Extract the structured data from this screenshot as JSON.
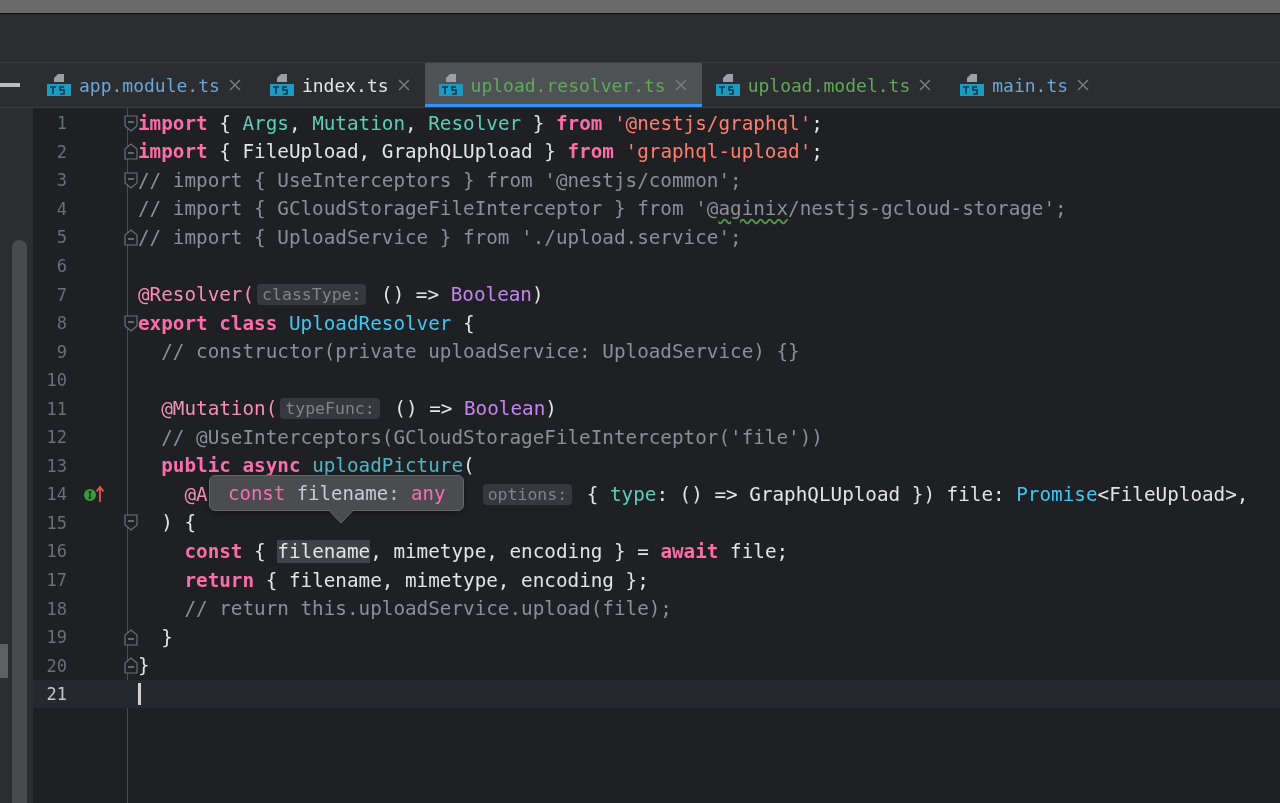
{
  "tabs": [
    {
      "label": "app.module.ts",
      "color": "#6aa7d8",
      "selected": false
    },
    {
      "label": "index.ts",
      "color": "#e6e6e6",
      "selected": false
    },
    {
      "label": "upload.resolver.ts",
      "color": "#62a85a",
      "selected": true
    },
    {
      "label": "upload.model.ts",
      "color": "#62a85a",
      "selected": false
    },
    {
      "label": "main.ts",
      "color": "#6aa7d8",
      "selected": false
    }
  ],
  "editor": {
    "lines": [
      {
        "number": "1",
        "fold_start": true,
        "tokens": [
          {
            "kind": "kw",
            "text": "import"
          },
          {
            "kind": "plain",
            "text": " { "
          },
          {
            "kind": "id",
            "text": "Args"
          },
          {
            "kind": "plain",
            "text": ", "
          },
          {
            "kind": "id",
            "text": "Mutation"
          },
          {
            "kind": "plain",
            "text": ", "
          },
          {
            "kind": "id",
            "text": "Resolver"
          },
          {
            "kind": "plain",
            "text": " } "
          },
          {
            "kind": "kw",
            "text": "from"
          },
          {
            "kind": "str",
            "text": " '@nestjs/graphql'"
          },
          {
            "kind": "plain",
            "text": ";"
          }
        ]
      },
      {
        "number": "2",
        "fold_end": true,
        "tokens": [
          {
            "kind": "kw",
            "text": "import"
          },
          {
            "kind": "plain",
            "text": " { FileUpload, GraphQLUpload } "
          },
          {
            "kind": "kw",
            "text": "from"
          },
          {
            "kind": "str",
            "text": " 'graphql-upload'"
          },
          {
            "kind": "plain",
            "text": ";"
          }
        ]
      },
      {
        "number": "3",
        "fold_start": true,
        "tokens": [
          {
            "kind": "com",
            "text": "// import { UseInterceptors } from '@nestjs/common';"
          }
        ]
      },
      {
        "number": "4",
        "tokens": [
          {
            "kind": "com",
            "text": "// import { GCloudStorageFileInterceptor } from '@"
          },
          {
            "kind": "com",
            "text": "aginix",
            "typo": true
          },
          {
            "kind": "com",
            "text": "/nestjs-gcloud-storage';"
          }
        ]
      },
      {
        "number": "5",
        "fold_end": true,
        "tokens": [
          {
            "kind": "com",
            "text": "// import { UploadService } from './upload.service';"
          }
        ]
      },
      {
        "number": "6"
      },
      {
        "number": "7",
        "tokens": [
          {
            "kind": "deco",
            "text": "@Resolver("
          },
          {
            "kind": "hint",
            "text": "classType:"
          },
          {
            "kind": "plain",
            "text": " () => "
          },
          {
            "kind": "type",
            "text": "Boolean"
          },
          {
            "kind": "plain",
            "text": ")"
          }
        ]
      },
      {
        "number": "8",
        "fold_start": true,
        "tokens": [
          {
            "kind": "kw",
            "text": "export class"
          },
          {
            "kind": "cls",
            "text": " UploadResolver"
          },
          {
            "kind": "plain",
            "text": " {"
          }
        ]
      },
      {
        "number": "9",
        "tokens": [
          {
            "kind": "com",
            "text": "  // constructor(private uploadService: UploadService) {}"
          }
        ]
      },
      {
        "number": "10"
      },
      {
        "number": "11",
        "tokens": [
          {
            "kind": "deco",
            "text": "  @Mutation("
          },
          {
            "kind": "hint",
            "text": "typeFunc:"
          },
          {
            "kind": "plain",
            "text": " () => "
          },
          {
            "kind": "type",
            "text": "Boolean"
          },
          {
            "kind": "plain",
            "text": ")"
          }
        ]
      },
      {
        "number": "12",
        "tokens": [
          {
            "kind": "com",
            "text": "  // @UseInterceptors(GCloudStorageFileInterceptor('file'))"
          }
        ]
      },
      {
        "number": "13",
        "tokens": [
          {
            "kind": "kw",
            "text": "  public async"
          },
          {
            "kind": "fn",
            "text": " uploadPicture"
          },
          {
            "kind": "plain",
            "text": "("
          }
        ]
      },
      {
        "number": "14",
        "implements_marker": true,
        "tokens": [
          {
            "kind": "deco",
            "text": "    @A",
            "covered": true
          },
          {
            "kind": "hint",
            "text": "options:"
          },
          {
            "kind": "plain",
            "text": " { "
          },
          {
            "kind": "prop",
            "text": "type"
          },
          {
            "kind": "plain",
            "text": ": () => GraphQLUpload }) file: "
          },
          {
            "kind": "cls",
            "text": "Promise"
          },
          {
            "kind": "plain",
            "text": "<FileUpload>,"
          }
        ]
      },
      {
        "number": "15",
        "fold_start": true,
        "tokens": [
          {
            "kind": "plain",
            "text": "  ) {"
          }
        ]
      },
      {
        "number": "16",
        "tokens": [
          {
            "kind": "kw",
            "text": "    const"
          },
          {
            "kind": "plain",
            "text": " { "
          },
          {
            "kind": "plain",
            "text": "filename",
            "highlighted": true
          },
          {
            "kind": "plain",
            "text": ", mimetype, encoding } = "
          },
          {
            "kind": "kw",
            "text": "await"
          },
          {
            "kind": "plain",
            "text": " file;"
          }
        ]
      },
      {
        "number": "17",
        "tokens": [
          {
            "kind": "kw",
            "text": "    return"
          },
          {
            "kind": "plain",
            "text": " { filename, mimetype, encoding };"
          }
        ]
      },
      {
        "number": "18",
        "tokens": [
          {
            "kind": "com",
            "text": "    // return this.uploadService.upload(file);"
          }
        ]
      },
      {
        "number": "19",
        "fold_end": true,
        "tokens": [
          {
            "kind": "plain",
            "text": "  }"
          }
        ]
      },
      {
        "number": "20",
        "fold_end": true,
        "tokens": [
          {
            "kind": "plain",
            "text": "}"
          }
        ]
      },
      {
        "number": "21",
        "current": true
      }
    ],
    "tooltip": {
      "tokens": [
        {
          "kind": "kw",
          "text": "const"
        },
        {
          "kind": "plain",
          "text": " filename"
        },
        {
          "kind": "punct",
          "text": ": "
        },
        {
          "kind": "kw",
          "text": "any"
        }
      ]
    }
  }
}
